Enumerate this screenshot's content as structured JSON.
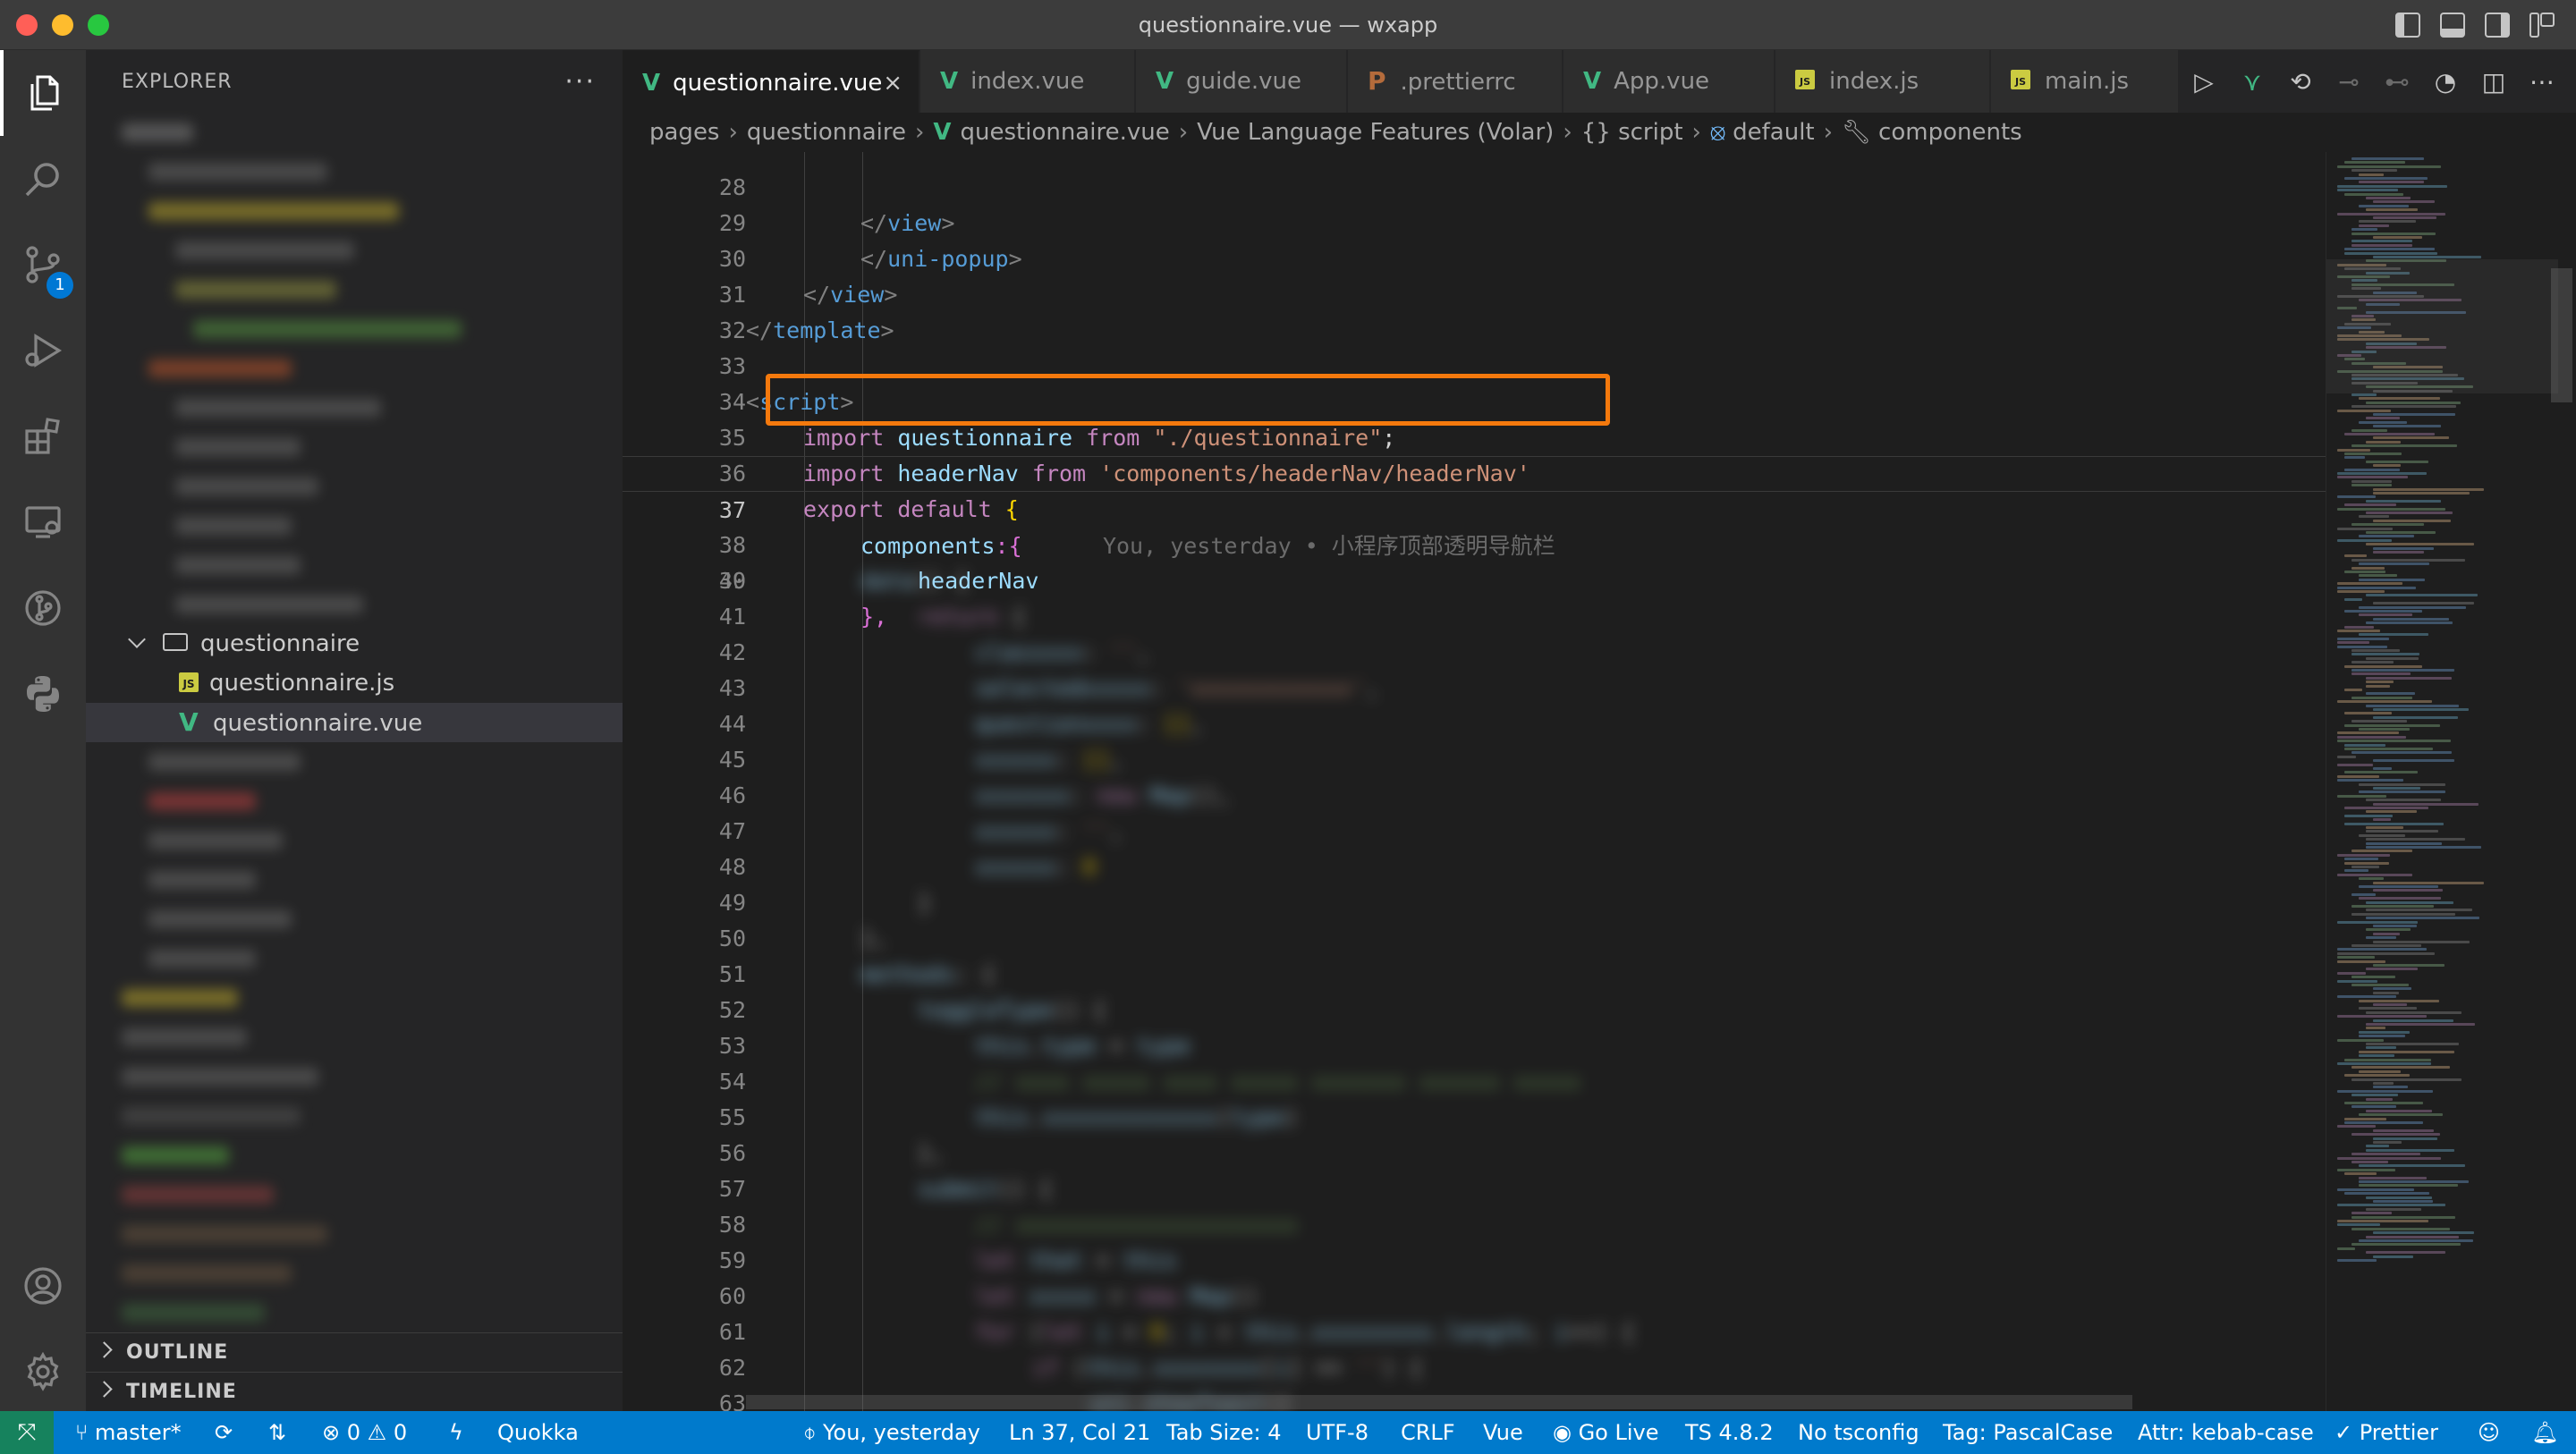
{
  "window": {
    "title": "questionnaire.vue — wxapp"
  },
  "activity_bar": {
    "items": [
      "explorer-icon",
      "search-icon",
      "source-control-icon",
      "run-debug-icon",
      "extensions-icon",
      "remote-explorer-icon",
      "git-graph-icon",
      "python-icon"
    ],
    "source_control_badge": "1",
    "bottom_items": [
      "account-icon",
      "settings-gear-icon"
    ]
  },
  "sidebar": {
    "title": "EXPLORER",
    "more": "···",
    "tree": {
      "folder": "questionnaire",
      "files": [
        {
          "name": "questionnaire.js",
          "type": "js"
        },
        {
          "name": "questionnaire.vue",
          "type": "vue",
          "selected": true
        }
      ]
    },
    "sections": [
      "OUTLINE",
      "TIMELINE"
    ]
  },
  "tabs": [
    {
      "label": "questionnaire.vue",
      "type": "vue",
      "active": true,
      "close": "×"
    },
    {
      "label": "index.vue",
      "type": "vue"
    },
    {
      "label": "guide.vue",
      "type": "vue"
    },
    {
      "label": ".prettierrc",
      "type": "prettier"
    },
    {
      "label": "App.vue",
      "type": "vue"
    },
    {
      "label": "index.js",
      "type": "js"
    },
    {
      "label": "main.js",
      "type": "js"
    }
  ],
  "tab_actions": [
    "run-icon",
    "vue-devtools-icon",
    "go-back-icon",
    "timeline-prev-icon",
    "timeline-next-icon",
    "git-lens-icon",
    "split-editor-icon",
    "more-actions-icon"
  ],
  "breadcrumb": [
    "pages",
    "questionnaire",
    "questionnaire.vue",
    "Vue Language Features (Volar)",
    "{} script",
    "default",
    "components"
  ],
  "editor": {
    "lines": [
      {
        "n": "28",
        "text": "</view>"
      },
      {
        "n": "29",
        "text": "</uni-popup>"
      },
      {
        "n": "30",
        "text": "</view>"
      },
      {
        "n": "31",
        "text": "</template>"
      },
      {
        "n": "32",
        "text": ""
      },
      {
        "n": "33",
        "text": "<script>"
      },
      {
        "n": "34",
        "kw1": "import",
        "id": "questionnaire",
        "kw2": "from",
        "str": "\"./questionnaire\"",
        "end": ";"
      },
      {
        "n": "35",
        "kw1": "import",
        "id": "headerNav",
        "kw2": "from",
        "str": "'components/headerNav/headerNav'",
        "end": ""
      },
      {
        "n": "36",
        "kw1": "export",
        "kw2": "default",
        "end": "{"
      },
      {
        "n": "37",
        "id": "components",
        "end": ":{",
        "blame": "You, yesterday • 小程序顶部透明导航栏"
      },
      {
        "n": "38",
        "id": "headerNav"
      },
      {
        "n": "39",
        "end": "},"
      },
      {
        "n": "40"
      },
      {
        "n": "41"
      },
      {
        "n": "42"
      },
      {
        "n": "43"
      },
      {
        "n": "44"
      },
      {
        "n": "45"
      },
      {
        "n": "46"
      },
      {
        "n": "47"
      },
      {
        "n": "48"
      },
      {
        "n": "49"
      },
      {
        "n": "50"
      },
      {
        "n": "51"
      },
      {
        "n": "52"
      },
      {
        "n": "53"
      },
      {
        "n": "54"
      },
      {
        "n": "55"
      },
      {
        "n": "56"
      },
      {
        "n": "57"
      },
      {
        "n": "58"
      },
      {
        "n": "59"
      },
      {
        "n": "60"
      },
      {
        "n": "61"
      },
      {
        "n": "62"
      },
      {
        "n": "63"
      }
    ]
  },
  "statusbar": {
    "branch": "master*",
    "errors": "0",
    "warnings": "0",
    "quokka": "Quokka",
    "blame": "You, yesterday",
    "position": "Ln 37, Col 21",
    "tab_size": "Tab Size: 4",
    "encoding": "UTF-8",
    "eol": "CRLF",
    "language": "Vue",
    "go_live": "Go Live",
    "ts_version": "TS 4.8.2",
    "tsconfig": "No tsconfig",
    "tag_case": "Tag: PascalCase",
    "attr_case": "Attr: kebab-case",
    "prettier": "Prettier"
  },
  "colors": {
    "accent": "#007acc",
    "highlight_box": "#f4790d",
    "vue_green": "#41b883"
  }
}
